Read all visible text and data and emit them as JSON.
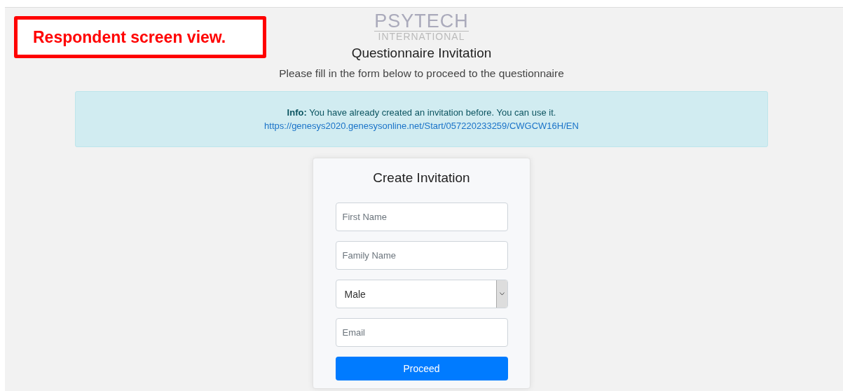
{
  "annotation": "Respondent screen view.",
  "logo": {
    "name": "PSYTECH",
    "subtitle": "INTERNATIONAL"
  },
  "title": "Questionnaire Invitation",
  "subtitle": "Please fill in the form below to proceed to the questionnaire",
  "info": {
    "message": "**Info:** You have already created an invitation before. You can use it.",
    "link": "https://genesys2020.genesysonline.net/Start/057220233259/CWGCW16H/EN"
  },
  "form": {
    "title": "Create Invitation",
    "fields": [
      {
        "kind": "text",
        "placeholder": "First Name"
      },
      {
        "kind": "text",
        "placeholder": "Family Name"
      },
      {
        "kind": "select",
        "value": "Male"
      },
      {
        "kind": "text",
        "placeholder": "Email"
      }
    ],
    "button": "Proceed"
  }
}
